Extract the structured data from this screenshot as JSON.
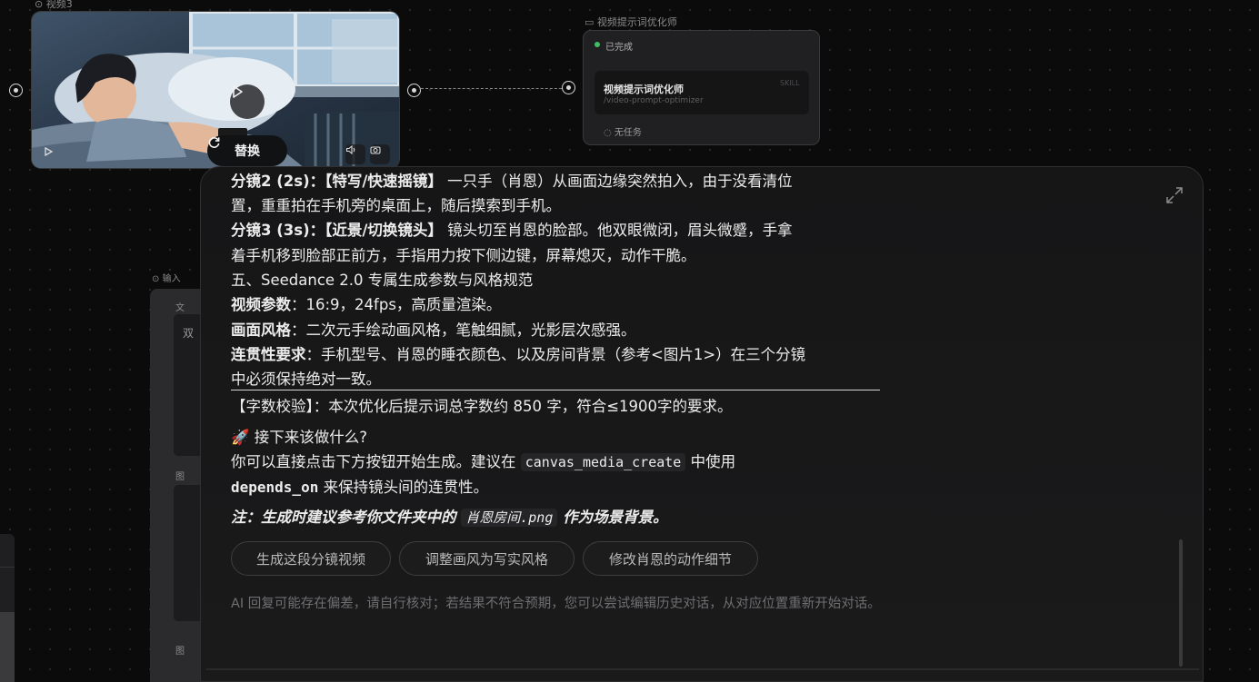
{
  "video_node": {
    "label": "视频3",
    "replace_label": "替换",
    "icons": [
      "play-icon",
      "refresh-icon",
      "volume-icon",
      "camera-icon"
    ]
  },
  "optimizer_node": {
    "title": "视频提示词优化师",
    "status": "已完成",
    "skill_name": "视频提示词优化师",
    "skill_path": "/video-prompt-optimizer",
    "skill_badge": "SKILL",
    "task_text": "无任务",
    "status_color": "#3fbf5f"
  },
  "input_node": {
    "label": "输入",
    "field_label_1": "文",
    "field_text_1": "双",
    "field_label_2": "图",
    "field_label_3": "图"
  },
  "chat": {
    "lines": [
      {
        "head": "分镜2 (2s)：【特写/快速摇镜】",
        "text": " 一只手（肖恩）从画面边缘突然拍入，由于没看清位"
      },
      {
        "head": "",
        "text": "置，重重拍在手机旁的桌面上，随后摸索到手机。"
      },
      {
        "head": "分镜3 (3s)：【近景/切换镜头】",
        "text": " 镜头切至肖恩的脸部。他双眼微闭，眉头微蹙，手拿"
      },
      {
        "head": "",
        "text": "着手机移到脸部正前方，手指用力按下侧边键，屏幕熄灭，动作干脆。"
      },
      {
        "head": "",
        "text": "五、Seedance 2.0 专属生成参数与风格规范"
      },
      {
        "head": "视频参数",
        "text": "：16:9，24fps，高质量渲染。"
      },
      {
        "head": "画面风格",
        "text": "：二次元手绘动画风格，笔触细腻，光影层次感强。"
      },
      {
        "head": "连贯性要求",
        "text": "：手机型号、肖恩的睡衣颜色、以及房间背景（参考<图片1>）在三个分镜"
      },
      {
        "head": "",
        "text": "中必须保持绝对一致。"
      },
      {
        "head": "",
        "text": "【字数校验】：本次优化后提示词总字数约 850 字，符合≤1900字的要求。"
      }
    ],
    "next_heading": "🚀 接下来该做什么?",
    "next_p1_a": "你可以直接点击下方按钮开始生成。建议在 ",
    "next_p1_code": "canvas_media_create",
    "next_p1_b": " 中使用",
    "next_p2_code": "depends_on",
    "next_p2_b": " 来保持镜头间的连贯性。",
    "note_a": "注：生成时建议参考你文件夹中的 ",
    "note_code": "肖恩房间.png",
    "note_b": " 作为场景背景。",
    "chips": [
      "生成这段分镜视频",
      "调整画风为写实风格",
      "修改肖恩的动作细节"
    ],
    "disclaimer": "AI 回复可能存在偏差，请自行核对；若结果不符合预期，您可以尝试编辑历史对话，从对应位置重新开始对话。"
  }
}
